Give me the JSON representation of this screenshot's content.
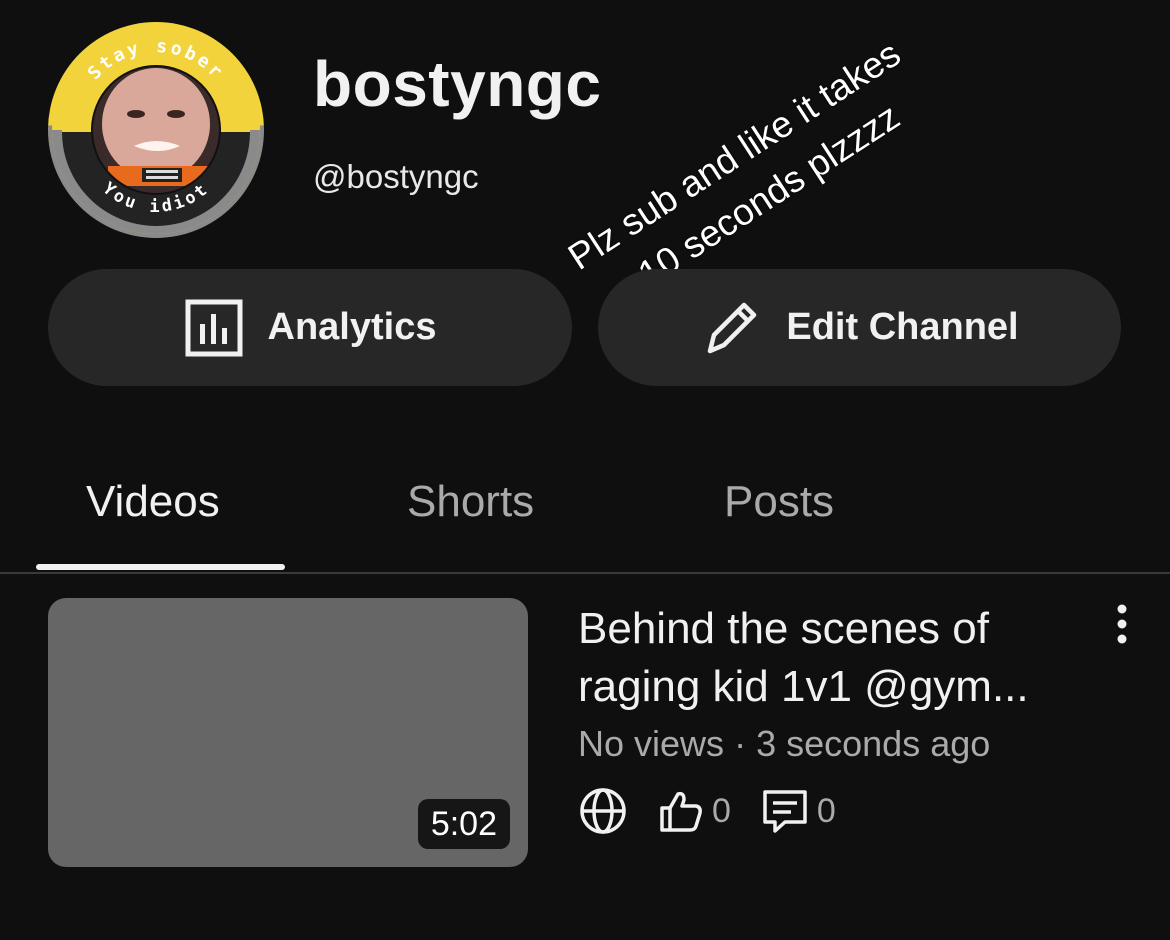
{
  "channel": {
    "name": "bostyngc",
    "handle": "@bostyngc",
    "avatar": {
      "top_text": "Stay sober",
      "bottom_text": "You idiot",
      "ring_top_color": "#f3d33b",
      "ring_bottom_color": "#8a8a8a"
    },
    "overlay_caption": {
      "line1": "Plz sub and like it takes",
      "line2": "10 seconds plzzzz"
    }
  },
  "actions": {
    "analytics": {
      "label": "Analytics",
      "icon": "analytics-icon"
    },
    "edit": {
      "label": "Edit Channel",
      "icon": "pencil-icon"
    }
  },
  "tabs": [
    {
      "label": "Videos",
      "active": true
    },
    {
      "label": "Shorts",
      "active": false
    },
    {
      "label": "Posts",
      "active": false
    }
  ],
  "videos": [
    {
      "title": "Behind the scenes of raging kid 1v1 @gym...",
      "duration": "5:02",
      "views": "No views",
      "separator": "·",
      "age": "3 seconds ago",
      "likes": "0",
      "comments": "0",
      "visibility_icon": "globe-icon"
    }
  ],
  "colors": {
    "background": "#0f0f0f",
    "button_bg": "#272727",
    "thumbnail_placeholder": "#666666",
    "secondary_text": "#aaaaaa"
  }
}
